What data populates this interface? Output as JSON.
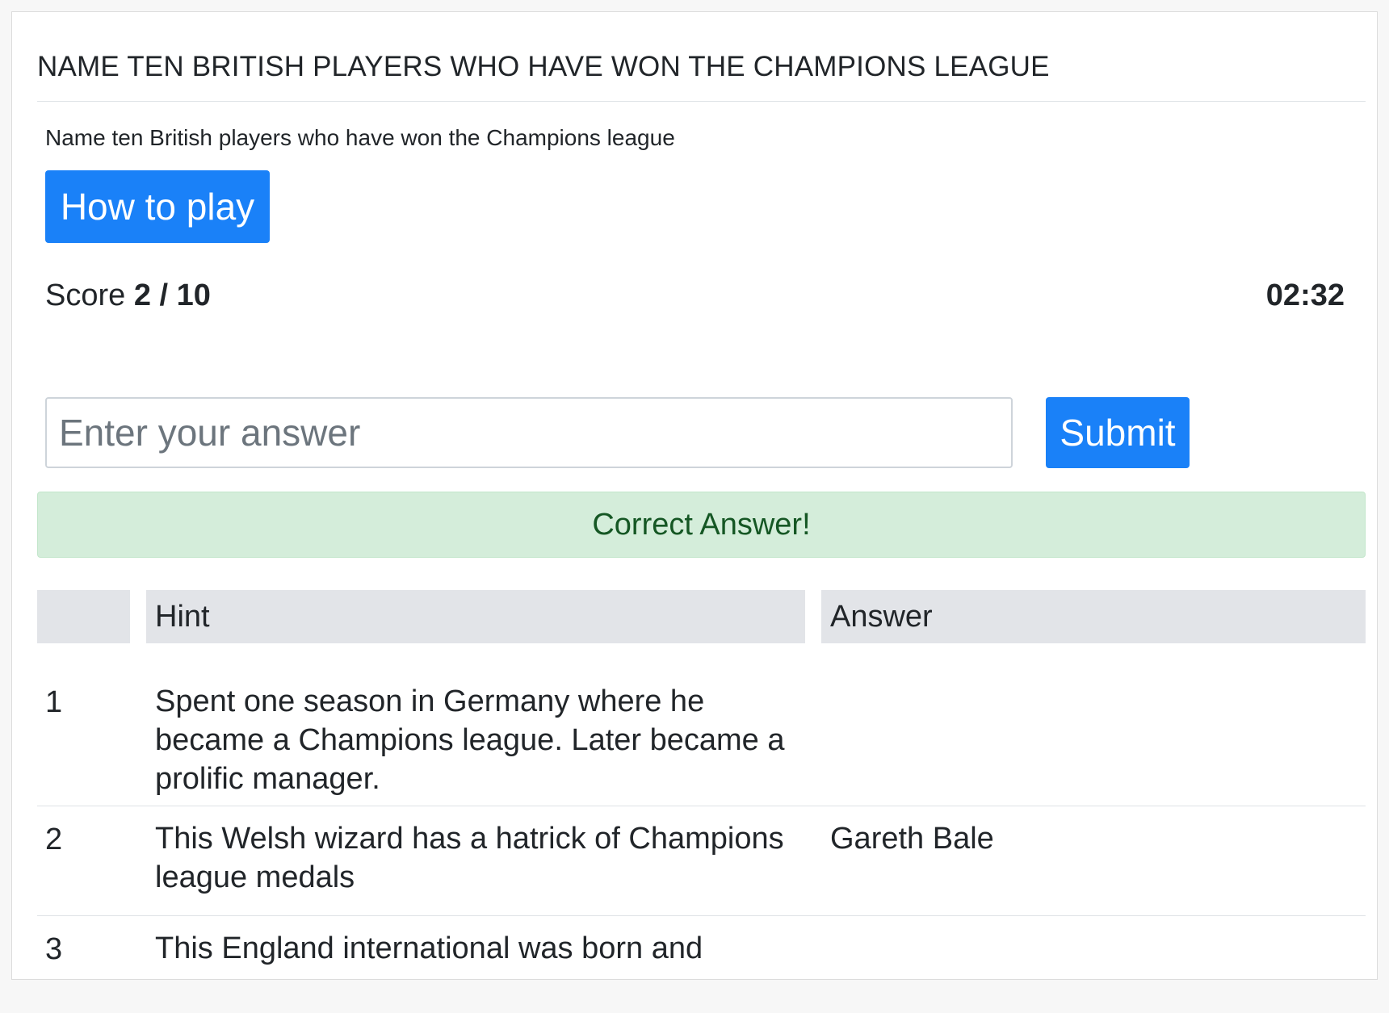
{
  "quiz": {
    "title": "NAME TEN BRITISH PLAYERS WHO HAVE WON THE CHAMPIONS LEAGUE",
    "subtitle": "Name ten British players who have won the Champions league",
    "how_to_play_label": "How to play",
    "score_label": "Score",
    "score_value": "2 / 10",
    "timer": "02:32",
    "answer_placeholder": "Enter your answer",
    "answer_value": "",
    "submit_label": "Submit",
    "feedback": "Correct Answer!"
  },
  "table": {
    "headers": [
      "",
      "Hint",
      "Answer"
    ],
    "rows": [
      {
        "num": "1",
        "hint": "Spent one season in Germany where he became a Champions league. Later became a prolific manager.",
        "answer": ""
      },
      {
        "num": "2",
        "hint": "This Welsh wizard has a hatrick of Champions league medals",
        "answer": "Gareth Bale"
      },
      {
        "num": "3",
        "hint": "This England international was born and",
        "answer": ""
      }
    ]
  },
  "colors": {
    "primary": "#1a81f8",
    "success_bg": "#d4edda",
    "success_text": "#155724",
    "header_bg": "#e2e4e8"
  }
}
